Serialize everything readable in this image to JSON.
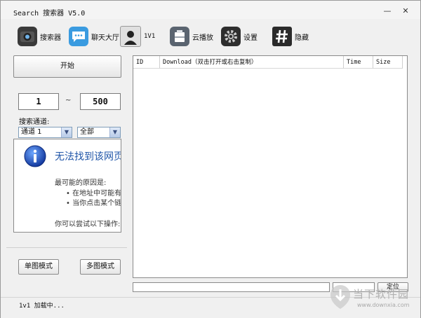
{
  "window": {
    "title": "Search 搜索器 V5.0",
    "minimize_glyph": "—",
    "close_glyph": "✕"
  },
  "toolbar": {
    "items": [
      {
        "label": "搜索器",
        "icon": "camera-icon",
        "color": "#333333"
      },
      {
        "label": "聊天大厅",
        "icon": "chat-bubble-icon",
        "color": "#3a9be0"
      },
      {
        "label": "1V1",
        "icon": "user-silhouette-icon",
        "color": "#2a2a2a"
      },
      {
        "label": "云播放",
        "icon": "cloud-play-icon",
        "color": "#5a6470"
      },
      {
        "label": "设置",
        "icon": "gear-icon",
        "color": "#333333"
      },
      {
        "label": "隐藏",
        "icon": "hash-icon",
        "color": "#2a2a2a"
      }
    ]
  },
  "left": {
    "start_label": "开始",
    "range_from": "1",
    "range_sep": "~",
    "range_to": "500",
    "channel_label": "搜索通道:",
    "channel_select": "通道 1",
    "filter_select": "全部",
    "single_mode_label": "单图模式",
    "multi_mode_label": "多图模式"
  },
  "error_page": {
    "heading": "无法找到该网页",
    "reason_title": "最可能的原因是:",
    "bullets": [
      "在地址中可能有",
      "当你点击某个链"
    ],
    "try_text": "你可以尝试以下操作:"
  },
  "list": {
    "columns": [
      "ID",
      "Download（双击打开或右击复制）",
      "Time",
      "Size"
    ]
  },
  "bottom": {
    "url_value": "",
    "locate_label": "定位"
  },
  "status": {
    "text": "1v1 加载中..."
  },
  "watermark": {
    "brand": "当下软件园",
    "url": "www.downxia.com"
  }
}
